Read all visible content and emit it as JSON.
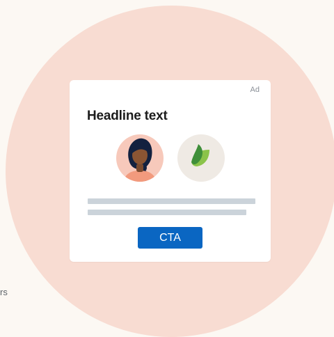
{
  "edge_text": "rs",
  "ad": {
    "label": "Ad",
    "headline": "Headline text",
    "cta_label": "CTA"
  },
  "avatars": [
    {
      "icon": "person-avatar-icon"
    },
    {
      "icon": "leaf-logo-icon"
    }
  ],
  "colors": {
    "page_background": "#fcf8f3",
    "circle": "#f8dcd2",
    "card": "#ffffff",
    "cta": "#0a66c2",
    "placeholder_lines": "#cbd3da",
    "leaf_light": "#8bc34a",
    "leaf_dark": "#3f8f3a"
  }
}
